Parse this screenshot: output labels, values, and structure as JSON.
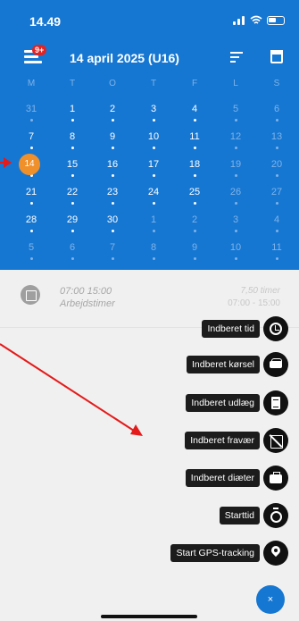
{
  "status_bar": {
    "time": "14.49"
  },
  "header": {
    "title": "14 april 2025 (U16)",
    "notification_count": "9+"
  },
  "calendar": {
    "weekdays": [
      "M",
      "T",
      "O",
      "T",
      "F",
      "L",
      "S"
    ],
    "weeks": [
      [
        "31",
        "1",
        "2",
        "3",
        "4",
        "5",
        "6"
      ],
      [
        "7",
        "8",
        "9",
        "10",
        "11",
        "12",
        "13"
      ],
      [
        "14",
        "15",
        "16",
        "17",
        "18",
        "19",
        "20"
      ],
      [
        "21",
        "22",
        "23",
        "24",
        "25",
        "26",
        "27"
      ],
      [
        "28",
        "29",
        "30",
        "1",
        "2",
        "3",
        "4"
      ],
      [
        "5",
        "6",
        "7",
        "8",
        "9",
        "10",
        "11"
      ]
    ],
    "selected_day": "14"
  },
  "event": {
    "time": "07:00 15:00",
    "title": "Arbejdstimer",
    "hours": "7,50 timer",
    "range": "07:00 - 15:00"
  },
  "actions": [
    {
      "label": "Indberet tid",
      "icon": "clock-icon"
    },
    {
      "label": "Indberet kørsel",
      "icon": "car-icon"
    },
    {
      "label": "Indberet udlæg",
      "icon": "receipt-icon"
    },
    {
      "label": "Indberet fravær",
      "icon": "absence-icon"
    },
    {
      "label": "Indberet diæter",
      "icon": "briefcase-icon"
    },
    {
      "label": "Starttid",
      "icon": "timer-icon"
    },
    {
      "label": "Start GPS-tracking",
      "icon": "location-pin-icon"
    }
  ],
  "fab": {
    "label": "×"
  },
  "colors": {
    "primary": "#1677d2",
    "today": "#f0902a",
    "annotation": "#e41b1b"
  }
}
